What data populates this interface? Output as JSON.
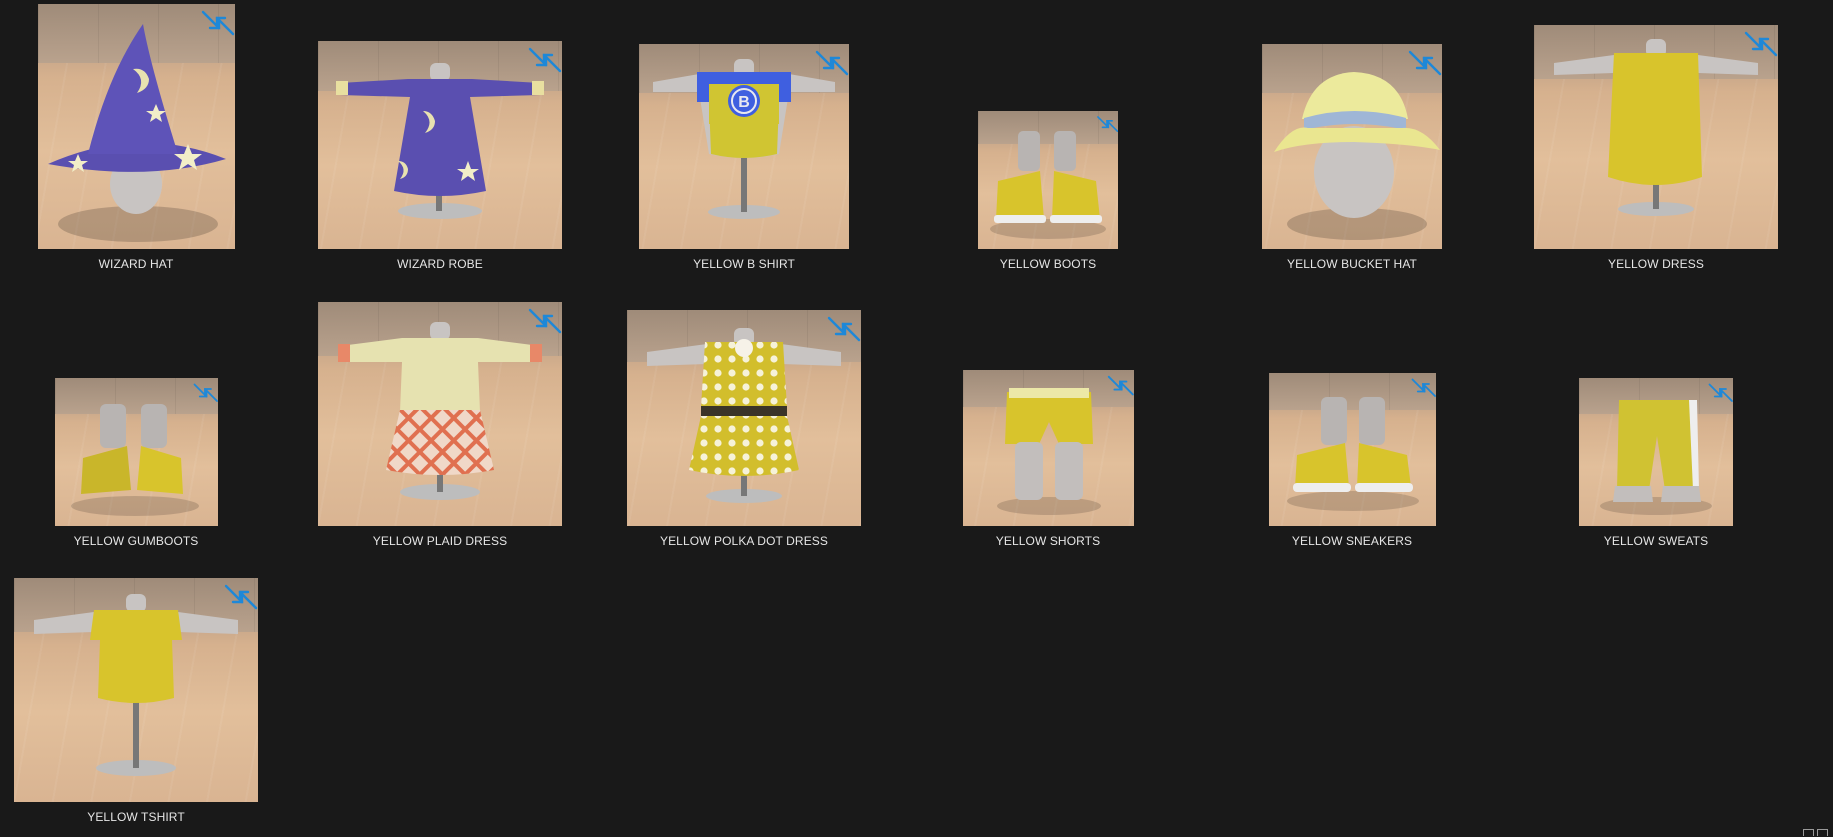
{
  "items": [
    {
      "name": "WIZARD HAT",
      "icon": "wizard-hat-icon"
    },
    {
      "name": "WIZARD ROBE",
      "icon": "wizard-robe-icon"
    },
    {
      "name": "YELLOW B SHIRT",
      "icon": "b-shirt-icon"
    },
    {
      "name": "YELLOW BOOTS",
      "icon": "boots-icon"
    },
    {
      "name": "YELLOW BUCKET HAT",
      "icon": "bucket-hat-icon"
    },
    {
      "name": "YELLOW DRESS",
      "icon": "dress-icon"
    },
    {
      "name": "YELLOW GUMBOOTS",
      "icon": "gumboots-icon"
    },
    {
      "name": "YELLOW PLAID DRESS",
      "icon": "plaid-dress-icon"
    },
    {
      "name": "YELLOW POLKA DOT DRESS",
      "icon": "polka-dot-dress-icon"
    },
    {
      "name": "YELLOW SHORTS",
      "icon": "shorts-icon"
    },
    {
      "name": "YELLOW SNEAKERS",
      "icon": "sneakers-icon"
    },
    {
      "name": "YELLOW SWEATS",
      "icon": "sweats-icon"
    },
    {
      "name": "YELLOW TSHIRT",
      "icon": "tshirt-icon"
    }
  ],
  "colors": {
    "background": "#191919",
    "label": "#e6e6e6",
    "shrink_badge": "#1e88d8",
    "wizard_purple": "#5a4fb0",
    "yellow_cloth": "#d8c42c"
  }
}
